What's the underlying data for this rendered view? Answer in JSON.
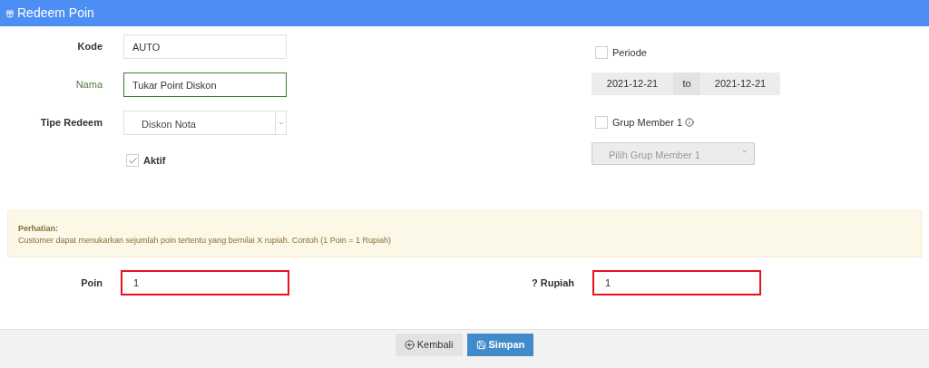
{
  "window": {
    "title": "Redeem Poin"
  },
  "fields": [
    {
      "label": "Kode",
      "value": "AUTO",
      "valid": false
    },
    {
      "label": "Nama",
      "value": "Tukar Point Diskon",
      "valid": true
    }
  ],
  "tipe_redeem": {
    "label": "Tipe Redeem",
    "value": "Diskon Nota"
  },
  "aktif": {
    "label": "Aktif",
    "checked": true
  },
  "periode": {
    "label": "Periode",
    "checked": false,
    "from": "2021-12-21",
    "separator": "to",
    "to": "2021-12-21"
  },
  "grup_member": {
    "label": "Grup Member 1",
    "checked": false,
    "placeholder": "Pilih Grup Member 1",
    "disabled": true
  },
  "notice": {
    "title": "Perhatian:",
    "text": "Customer dapat menukarkan sejumlah poin tertentu yang bernilai X rupiah. Contoh (1 Poin = 1 Rupiah)"
  },
  "conversion": [
    {
      "label": "Poin",
      "value": "1",
      "error": true
    },
    {
      "label": "? Rupiah",
      "value": "1",
      "error": true
    }
  ],
  "buttons": [
    {
      "label": "Kembali",
      "kind": "back"
    },
    {
      "label": "Simpan",
      "kind": "save"
    }
  ]
}
